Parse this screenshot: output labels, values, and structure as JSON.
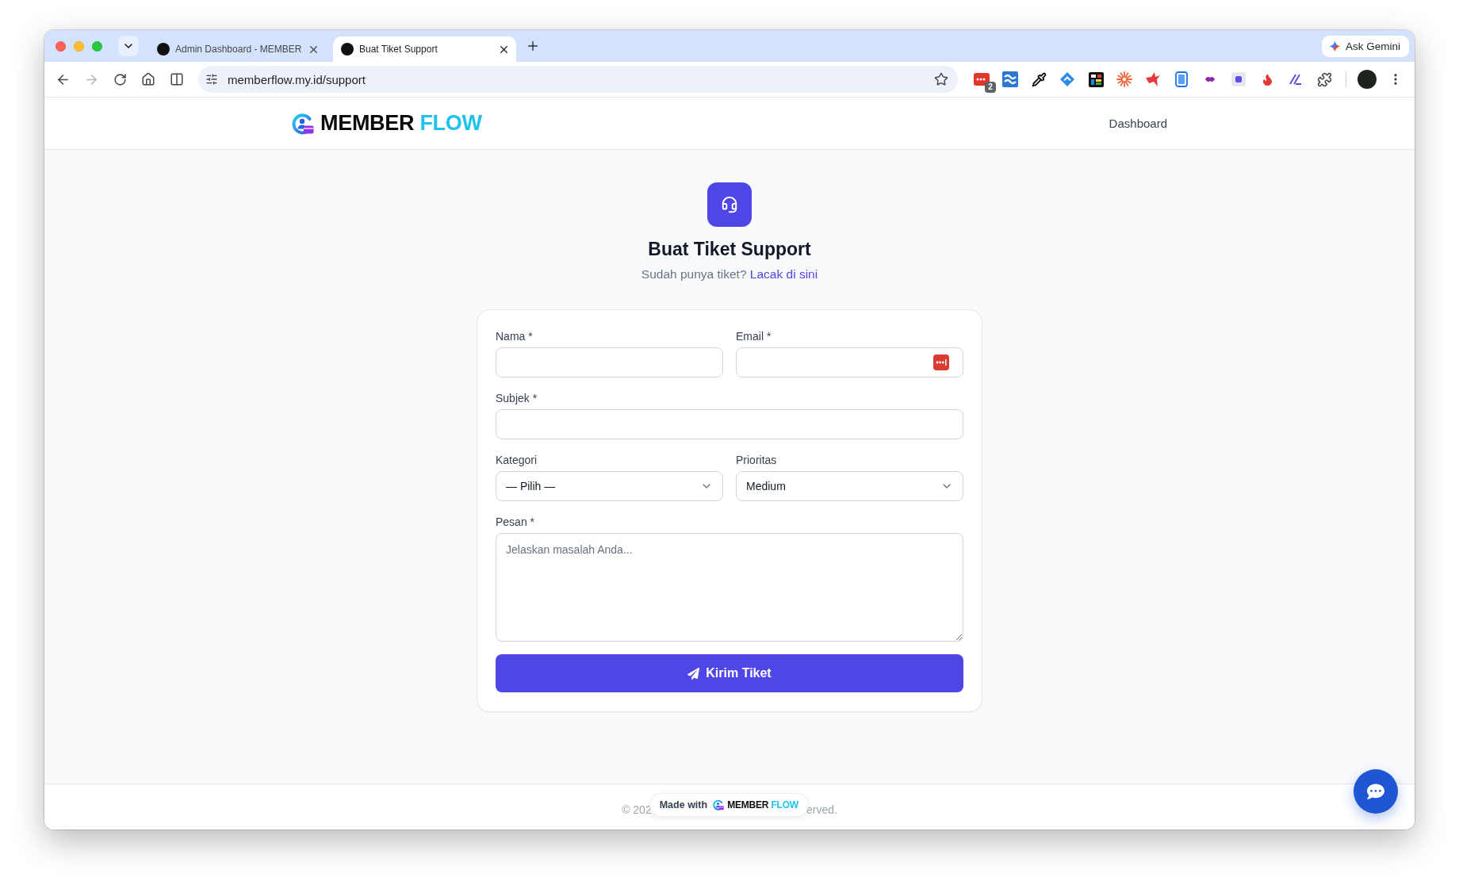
{
  "browser": {
    "tabs": [
      {
        "title": "Admin Dashboard - MEMBER",
        "selected": false
      },
      {
        "title": "Buat Tiket Support",
        "selected": true
      }
    ],
    "ask_button": "Ask Gemini",
    "forward_disabled": true,
    "address": "memberflow.my.id/support",
    "extension_badge": "2"
  },
  "header": {
    "logo": {
      "word_1": "MEMBER",
      "word_2": "FLOW"
    },
    "nav": [
      "Dashboard"
    ]
  },
  "hero": {
    "title": "Buat Tiket Support",
    "subtitle": "Sudah punya tiket?",
    "link": "Lacak di sini"
  },
  "form": {
    "rows": [
      [
        {
          "kind": "text",
          "label": "Nama *"
        },
        {
          "kind": "email",
          "label": "Email *"
        }
      ],
      [
        {
          "kind": "text",
          "label": "Subjek *"
        }
      ],
      [
        {
          "kind": "select",
          "label": "Kategori",
          "value": "— Pilih —"
        },
        {
          "kind": "select",
          "label": "Prioritas",
          "value": "Medium"
        }
      ],
      [
        {
          "kind": "textarea",
          "label": "Pesan *",
          "placeholder": "Jelaskan masalah Anda..."
        }
      ]
    ],
    "submit": "Kirim Tiket"
  },
  "footer": {
    "copyright_start": "© 202",
    "copyright_end": "erved.",
    "badge": {
      "prefix": "Made with",
      "word_1": "MEMBER",
      "word_2": "FLOW"
    }
  }
}
